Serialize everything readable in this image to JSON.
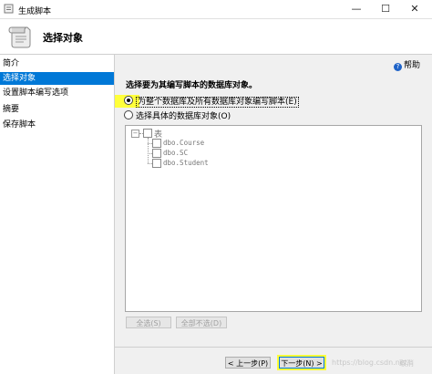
{
  "window": {
    "title": "生成脚本",
    "controls": {
      "minimize": "—",
      "maximize": "☐",
      "close": "✕"
    }
  },
  "header": {
    "title": "选择对象",
    "icon": "scroll-icon"
  },
  "sidebar": {
    "items": [
      {
        "label": "简介",
        "selected": false
      },
      {
        "label": "选择对象",
        "selected": true
      },
      {
        "label": "设置脚本编写选项",
        "selected": false
      },
      {
        "label": "摘要",
        "selected": false
      },
      {
        "label": "保存脚本",
        "selected": false
      }
    ]
  },
  "content": {
    "help_label": "帮助",
    "section_title": "选择要为其编写脚本的数据库对象。",
    "option_entire": "为整个数据库及所有数据库对象编写脚本(E)",
    "option_specific": "选择具体的数据库对象(O)",
    "tree": {
      "root_label": "表",
      "items": [
        "dbo.Course",
        "dbo.SC",
        "dbo.Student"
      ]
    },
    "select_all": "全选(S)",
    "deselect_all": "全部不选(D)"
  },
  "footer": {
    "prev": "< 上一步(P)",
    "next": "下一步(N) >",
    "watermark_1": "https://blog.csdn.net/",
    "watermark_2": "取消"
  },
  "colors": {
    "selection": "#0078d7",
    "highlight": "#ffff3a"
  }
}
